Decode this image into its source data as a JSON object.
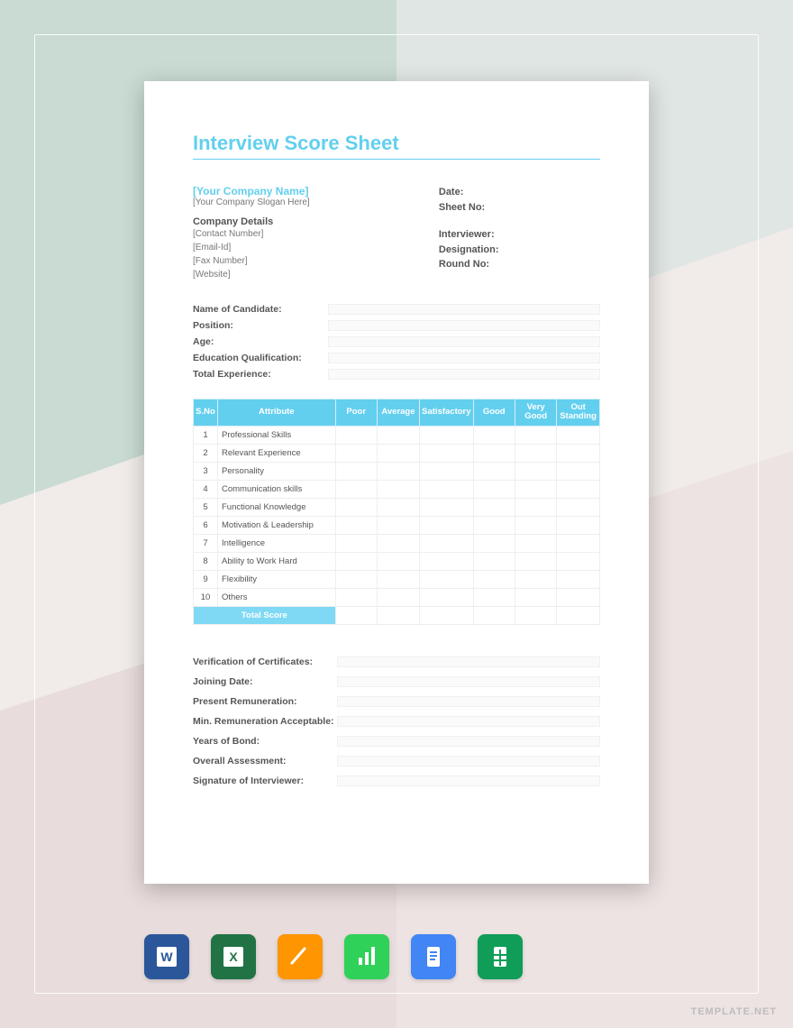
{
  "title": "Interview Score Sheet",
  "company": {
    "name": "[Your Company Name]",
    "slogan": "[Your Company Slogan Here]",
    "details_heading": "Company Details",
    "details": [
      "[Contact Number]",
      "[Email-Id]",
      "[Fax Number]",
      "[Website]"
    ]
  },
  "meta": {
    "date": "Date:",
    "sheet_no": "Sheet No:",
    "interviewer": "Interviewer:",
    "designation": "Designation:",
    "round_no": "Round No:"
  },
  "candidate_fields": [
    "Name of Candidate:",
    "Position:",
    "Age:",
    "Education Qualification:",
    "Total Experience:"
  ],
  "score_table": {
    "headers": [
      "S.No",
      "Attribute",
      "Poor",
      "Average",
      "Satisfactory",
      "Good",
      "Very Good",
      "Out Standing"
    ],
    "rows": [
      {
        "n": "1",
        "attr": "Professional Skills"
      },
      {
        "n": "2",
        "attr": "Relevant Experience"
      },
      {
        "n": "3",
        "attr": "Personality"
      },
      {
        "n": "4",
        "attr": "Communication skills"
      },
      {
        "n": "5",
        "attr": "Functional Knowledge"
      },
      {
        "n": "6",
        "attr": "Motivation & Leadership"
      },
      {
        "n": "7",
        "attr": "Intelligence"
      },
      {
        "n": "8",
        "attr": "Ability to Work Hard"
      },
      {
        "n": "9",
        "attr": "Flexibility"
      },
      {
        "n": "10",
        "attr": "Others"
      }
    ],
    "total_label": "Total Score"
  },
  "bottom_fields": [
    "Verification of Certificates:",
    "Joining Date:",
    "Present Remuneration:",
    "Min. Remuneration Acceptable:",
    "Years of Bond:",
    "Overall Assessment:",
    "Signature of Interviewer:"
  ],
  "app_icons": [
    "word-icon",
    "excel-icon",
    "pages-icon",
    "numbers-icon",
    "google-docs-icon",
    "google-sheets-icon"
  ],
  "watermark": "TEMPLATE.NET"
}
